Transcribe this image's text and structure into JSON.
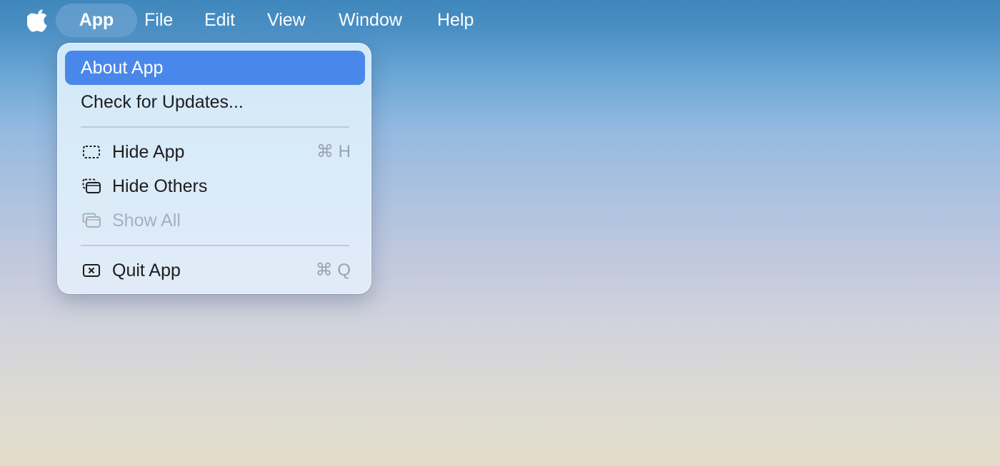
{
  "menubar": {
    "apple_icon": "apple-logo-icon",
    "items": [
      {
        "label": "App",
        "active": true
      },
      {
        "label": "File"
      },
      {
        "label": "Edit"
      },
      {
        "label": "View"
      },
      {
        "label": "Window"
      },
      {
        "label": "Help"
      }
    ]
  },
  "dropdown": {
    "items": [
      {
        "label": "About App",
        "highlighted": true
      },
      {
        "label": "Check for Updates..."
      },
      {
        "label": "Hide App",
        "shortcut": "⌘ H",
        "icon": "hide-window-icon"
      },
      {
        "label": "Hide Others",
        "icon": "hide-others-icon"
      },
      {
        "label": "Show All",
        "icon": "show-all-icon",
        "disabled": true
      },
      {
        "label": "Quit App",
        "shortcut": "⌘ Q",
        "icon": "quit-icon"
      }
    ]
  },
  "colors": {
    "highlight": "#4a87ea",
    "text": "#1d1d1f",
    "disabled_text": "#a6afbd",
    "shortcut_text": "#9aa3ae"
  }
}
